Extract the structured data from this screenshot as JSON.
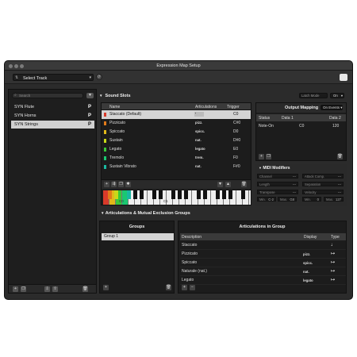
{
  "window": {
    "title": "Expression Map Setup"
  },
  "toolbar": {
    "track_select_label": "Select Track"
  },
  "left_panel": {
    "search_placeholder": "Search",
    "items": [
      {
        "label": "SYN Flute",
        "badge": "P",
        "selected": false
      },
      {
        "label": "SYN Horns",
        "badge": "P",
        "selected": false
      },
      {
        "label": "SYN Strings",
        "badge": "P",
        "selected": true
      }
    ]
  },
  "sound_slots": {
    "title": "Sound Slots",
    "columns": {
      "name": "Name",
      "articulations": "Articulations",
      "trigger": "Trigger"
    },
    "rows": [
      {
        "name": "Staccato (Default)",
        "articulation": "'",
        "trigger": "C0",
        "color": "#d83a2a",
        "selected": true
      },
      {
        "name": "Pizzicato",
        "articulation": "pizz.",
        "trigger": "C#0",
        "color": "#e07a1a",
        "selected": false
      },
      {
        "name": "Spiccato",
        "articulation": "spicc.",
        "trigger": "D0",
        "color": "#e0b81a",
        "selected": false
      },
      {
        "name": "Sustain",
        "articulation": "nat.",
        "trigger": "D#0",
        "color": "#c8d81a",
        "selected": false
      },
      {
        "name": "Legato",
        "articulation": "legato",
        "trigger": "E0",
        "color": "#38c838",
        "selected": false
      },
      {
        "name": "Tremolo",
        "articulation": "trem.",
        "trigger": "F0",
        "color": "#1ac870",
        "selected": false
      },
      {
        "name": "Sustain Vibrato",
        "articulation": "nat.",
        "trigger": "F#0",
        "color": "#1ab8a0",
        "selected": false
      }
    ],
    "keyboard_labels": [
      "C0",
      "C1"
    ]
  },
  "output_mapping": {
    "latch_mode_label": "Latch Mode",
    "latch_mode_value": "On",
    "title": "Output Mapping",
    "event_mode": "On Events",
    "columns": [
      "Status",
      "Data 1",
      "Data 2"
    ],
    "row": [
      "Note-On",
      "C0",
      "120"
    ]
  },
  "midi_modifiers": {
    "title": "MIDI Modifiers",
    "fields": [
      {
        "label": "Channel",
        "value": "---"
      },
      {
        "label": "Attack Comp.",
        "value": "---"
      },
      {
        "label": "Length",
        "value": "---"
      },
      {
        "label": "Separation",
        "value": "---"
      },
      {
        "label": "Transpose",
        "value": "---"
      },
      {
        "label": "Velocity",
        "value": "---"
      }
    ],
    "min1_label": "Min.",
    "min1_value": "C-2",
    "max1_label": "Max.",
    "max1_value": "G8",
    "min2_label": "Min.",
    "min2_value": "0",
    "max2_label": "Max.",
    "max2_value": "127"
  },
  "ameg": {
    "title": "Articulations & Mutual Exclusion Groups",
    "groups_title": "Groups",
    "groups": [
      "Group 1"
    ],
    "aig_title": "Articulations in Group",
    "columns": {
      "description": "Description",
      "display": "Display",
      "type": "Type"
    },
    "rows": [
      {
        "description": "Staccato",
        "display": "",
        "type": "♩"
      },
      {
        "description": "Pizzicato",
        "display": "pizz.",
        "type": "↦"
      },
      {
        "description": "Spiccato",
        "display": "spicc.",
        "type": "↦"
      },
      {
        "description": "Naturale (nat.)",
        "display": "nat.",
        "type": "↦"
      },
      {
        "description": "Legato",
        "display": "legato",
        "type": "↦"
      }
    ]
  }
}
